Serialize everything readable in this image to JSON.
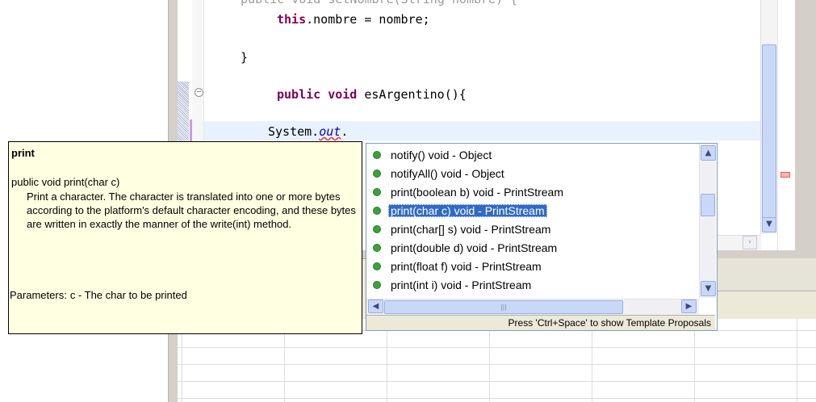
{
  "code": {
    "line_partial": "public void setNombre(String nombre) {",
    "this_kw": "this",
    "assign_rest": ".nombre = nombre;",
    "close_brace": "}",
    "public_kw": "public",
    "void_kw": "void",
    "method_sig": " esArgentino(){",
    "system_text": "System.",
    "out_text": "out",
    "dot_text": "."
  },
  "javadoc": {
    "title": "print",
    "signature": "public void print(char c)",
    "description": "Print a character. The character is translated into one or more bytes according to the platform's default character encoding, and these bytes are written in exactly the manner of the write(int) method.",
    "params_label": "Parameters:",
    "params_value": "c - The char to be printed"
  },
  "completion": {
    "items": [
      {
        "label": "notify()  void - Object"
      },
      {
        "label": "notifyAll()  void - Object"
      },
      {
        "label": "print(boolean b)  void - PrintStream"
      },
      {
        "label": "print(char c)  void - PrintStream"
      },
      {
        "label": "print(char[] s)  void - PrintStream"
      },
      {
        "label": "print(double d)  void - PrintStream"
      },
      {
        "label": "print(float f)  void - PrintStream"
      },
      {
        "label": "print(int i)  void - PrintStream"
      }
    ],
    "selected_index": 3,
    "status": "Press 'Ctrl+Space' to show Template Proposals"
  },
  "icons": {
    "scroll_up": "arrow-up-icon",
    "scroll_down": "arrow-down-icon",
    "scroll_left": "arrow-left-icon",
    "scroll_right": "arrow-right-icon",
    "fold": "collapse-icon",
    "method": "public-method-icon"
  },
  "colors": {
    "keyword": "#7f0055",
    "field": "#0000c0",
    "selection": "#316ac5",
    "tooltip_bg": "#ffffe1"
  }
}
